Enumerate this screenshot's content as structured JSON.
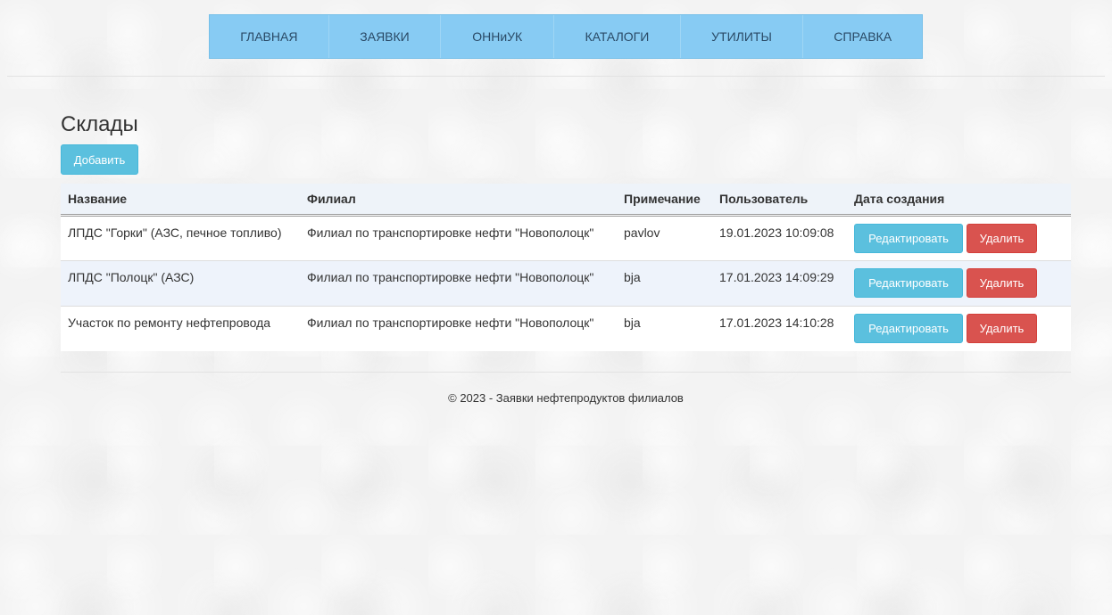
{
  "nav": {
    "items": [
      {
        "label": "ГЛАВНАЯ"
      },
      {
        "label": "ЗАЯВКИ"
      },
      {
        "label": "ОННиУК"
      },
      {
        "label": "КАТАЛОГИ"
      },
      {
        "label": "УТИЛИТЫ"
      },
      {
        "label": "СПРАВКА"
      }
    ]
  },
  "page": {
    "title": "Склады",
    "add_label": "Добавить"
  },
  "table": {
    "headers": [
      "Название",
      "Филиал",
      "Примечание",
      "Пользователь",
      "Дата создания"
    ],
    "rows": [
      {
        "name": "ЛПДС \"Горки\" (АЗС, печное топливо)",
        "branch": "Филиал по транспортировке нефти \"Новополоцк\"",
        "note": "pavlov",
        "user": "19.01.2023 10:09:08",
        "date": ""
      },
      {
        "name": "ЛПДС \"Полоцк\" (АЗС)",
        "branch": "Филиал по транспортировке нефти \"Новополоцк\"",
        "note": "bja",
        "user": "17.01.2023 14:09:29",
        "date": ""
      },
      {
        "name": "Участок по ремонту нефтепровода",
        "branch": "Филиал по транспортировке нефти \"Новополоцк\"",
        "note": "bja",
        "user": "17.01.2023 14:10:28",
        "date": ""
      }
    ],
    "edit_label": "Редактировать",
    "delete_label": "Удалить"
  },
  "footer": {
    "text": "© 2023 - Заявки нефтепродуктов филиалов"
  },
  "colors": {
    "navbar": "#87cbf3",
    "info": "#5bc0de",
    "danger": "#d9534f"
  }
}
